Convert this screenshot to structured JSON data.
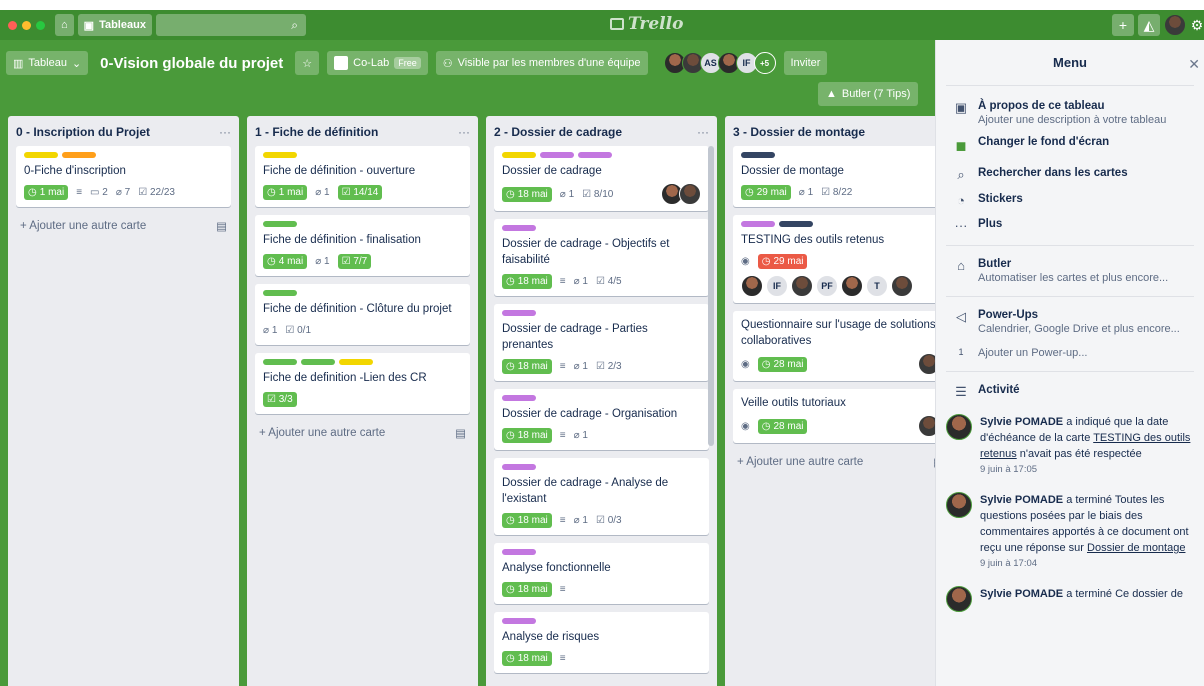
{
  "topbar": {
    "boards_label": "Tableaux",
    "logo_text": "Trello"
  },
  "board": {
    "view_label": "Tableau",
    "title": "0-Vision globale du projet",
    "team_label": "Co-Lab",
    "team_badge": "Free",
    "visibility_label": "Visible par les membres d'une équipe",
    "member_initials": [
      "AS",
      "IF"
    ],
    "more_members": "+5",
    "invite_label": "Inviter",
    "butler_label": "Butler (7 Tips)"
  },
  "lists": [
    {
      "title": "0 - Inscription du Projet",
      "add_label": "Ajouter une autre carte",
      "cards": [
        {
          "labels": [
            "#f2d600",
            "#ff9f1a"
          ],
          "title": "0-Fiche d'inscription",
          "date": "1 mai",
          "desc": true,
          "comments": "2",
          "attach": "7",
          "checklist": "22/23",
          "check_done": false
        }
      ]
    },
    {
      "title": "1 - Fiche de définition",
      "add_label": "Ajouter une autre carte",
      "cards": [
        {
          "labels": [
            "#f2d600"
          ],
          "title": "Fiche de définition - ouverture",
          "date": "1 mai",
          "attach": "1",
          "checklist": "14/14",
          "check_done": true
        },
        {
          "labels": [
            "#61bd4f"
          ],
          "title": "Fiche de définition - finalisation",
          "date": "4 mai",
          "attach": "1",
          "checklist": "7/7",
          "check_done": true
        },
        {
          "labels": [
            "#61bd4f"
          ],
          "title": "Fiche de définition - Clôture du projet",
          "attach": "1",
          "checklist": "0/1",
          "check_done": false
        },
        {
          "labels": [
            "#61bd4f",
            "#61bd4f",
            "#f2d600"
          ],
          "title": "Fiche de definition -Lien des CR",
          "checklist": "3/3",
          "check_done": true
        }
      ]
    },
    {
      "title": "2 - Dossier de cadrage",
      "add_label": "Ajouter une autre carte",
      "cards": [
        {
          "labels": [
            "#f2d600",
            "#c377e0",
            "#c377e0"
          ],
          "title": "Dossier de cadrage",
          "date": "18 mai",
          "attach": "1",
          "checklist": "8/10",
          "check_done": false,
          "members": [
            "photo",
            "photo2"
          ]
        },
        {
          "labels": [
            "#c377e0"
          ],
          "title": "Dossier de cadrage - Objectifs et faisabilité",
          "date": "18 mai",
          "desc": true,
          "attach": "1",
          "checklist": "4/5",
          "check_done": false
        },
        {
          "labels": [
            "#c377e0"
          ],
          "title": "Dossier de cadrage - Parties prenantes",
          "date": "18 mai",
          "desc": true,
          "attach": "1",
          "checklist": "2/3",
          "check_done": false
        },
        {
          "labels": [
            "#c377e0"
          ],
          "title": "Dossier de cadrage - Organisation",
          "date": "18 mai",
          "desc": true,
          "attach": "1"
        },
        {
          "labels": [
            "#c377e0"
          ],
          "title": "Dossier de cadrage - Analyse de l'existant",
          "date": "18 mai",
          "desc": true,
          "attach": "1",
          "checklist": "0/3",
          "check_done": false
        },
        {
          "labels": [
            "#c377e0"
          ],
          "title": "Analyse fonctionnelle",
          "date": "18 mai",
          "desc": true
        },
        {
          "labels": [
            "#c377e0"
          ],
          "title": "Analyse de risques",
          "date": "18 mai",
          "desc": true
        }
      ]
    },
    {
      "title": "3 - Dossier de montage",
      "add_label": "Ajouter une autre carte",
      "cards": [
        {
          "labels": [
            "#344563"
          ],
          "title": "Dossier de montage",
          "date": "29 mai",
          "attach": "1",
          "checklist": "8/22",
          "check_done": false
        },
        {
          "labels": [
            "#c377e0",
            "#344563"
          ],
          "title": "TESTING des outils retenus",
          "watch": true,
          "date": "29 mai",
          "date_over": true,
          "members": [
            "photo",
            "IF",
            "photo2",
            "PF",
            "photo",
            "T",
            "photo2"
          ]
        },
        {
          "labels": [],
          "title": "Questionnaire sur l'usage de solutions collaboratives",
          "watch": true,
          "date": "28 mai",
          "members": [
            "photo2"
          ]
        },
        {
          "labels": [],
          "title": "Veille outils tutoriaux",
          "watch": true,
          "date": "28 mai",
          "members": [
            "photo2"
          ]
        }
      ]
    }
  ],
  "menu": {
    "title": "Menu",
    "items": [
      {
        "icon": "board-icon",
        "glyph": "▣",
        "title": "À propos de ce tableau",
        "sub": "Ajouter une description à votre tableau"
      },
      {
        "icon": "background-icon",
        "glyph": "■",
        "title": "Changer le fond d'écran",
        "sub": ""
      },
      {
        "icon": "search-icon",
        "glyph": "⌕",
        "title": "Rechercher dans les cartes",
        "sub": ""
      },
      {
        "icon": "sticker-icon",
        "glyph": "◔",
        "title": "Stickers",
        "sub": ""
      },
      {
        "icon": "more-icon",
        "glyph": "···",
        "title": "Plus",
        "sub": ""
      }
    ],
    "butler": {
      "title": "Butler",
      "sub": "Automatiser les cartes et plus encore..."
    },
    "powerups": {
      "title": "Power-Ups",
      "sub": "Calendrier, Google Drive et plus encore...",
      "add": "Ajouter un Power-up...",
      "count": "1"
    },
    "activity_title": "Activité",
    "activities": [
      {
        "name": "Sylvie POMADE",
        "text_before": " a indiqué que la date d'échéance de la carte ",
        "link": "TESTING des outils retenus",
        "text_after": " n'avait pas été respectée",
        "time": "9 juin à 17:05"
      },
      {
        "name": "Sylvie POMADE",
        "text_before": " a terminé Toutes les questions posées par le biais des commentaires apportés à ce document ont reçu une réponse sur ",
        "link": "Dossier de montage",
        "text_after": "",
        "time": "9 juin à 17:04"
      },
      {
        "name": "Sylvie POMADE",
        "text_before": " a terminé Ce dossier de",
        "link": "",
        "text_after": "",
        "time": ""
      }
    ]
  }
}
